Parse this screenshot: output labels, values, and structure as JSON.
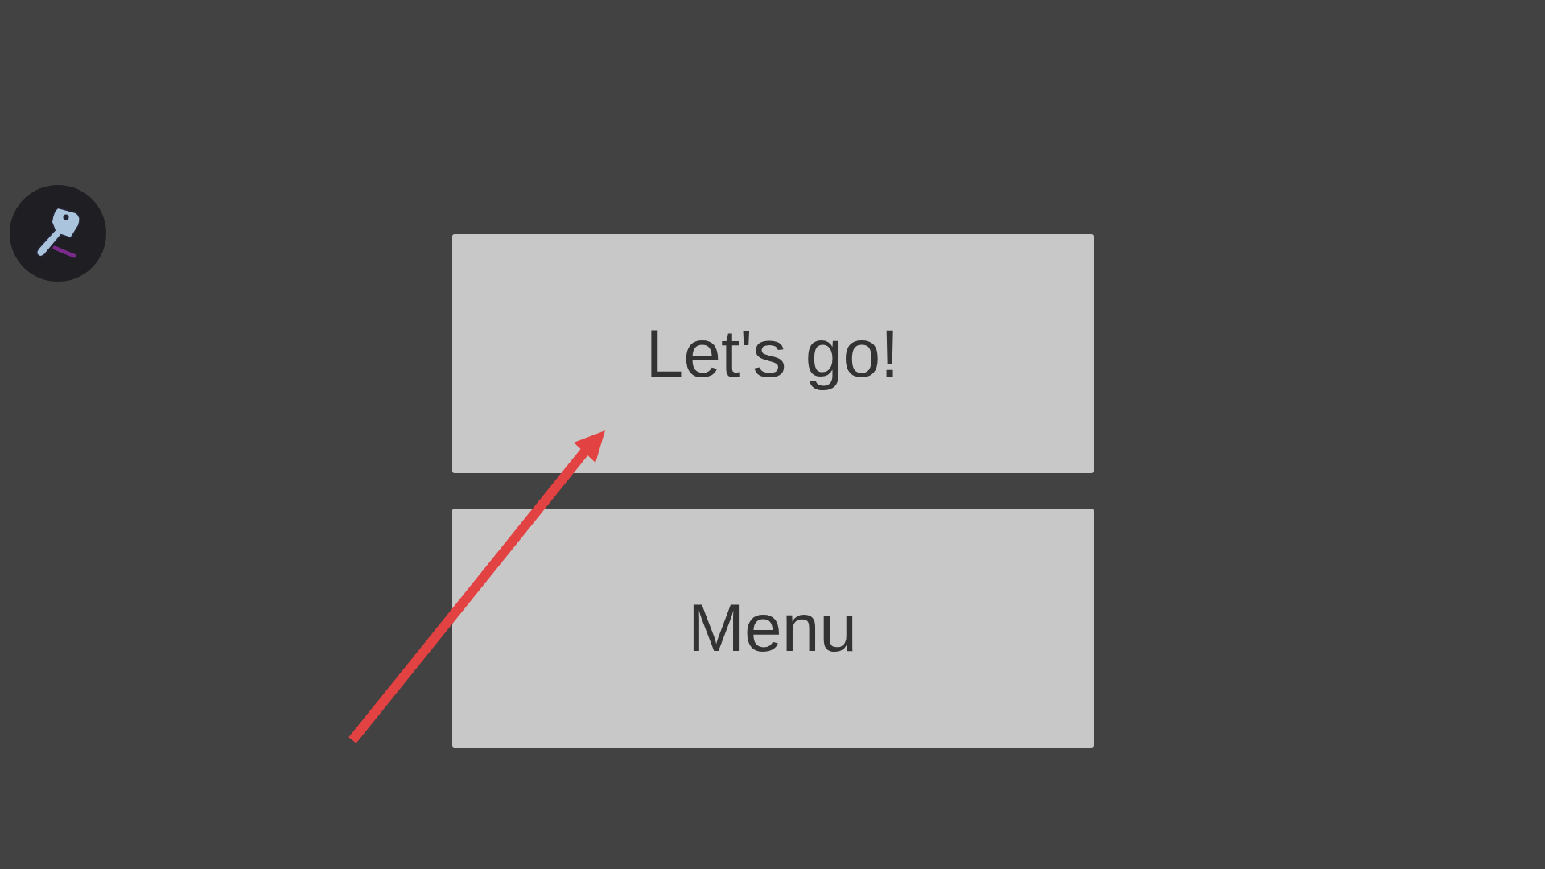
{
  "buttons": [
    {
      "label": "Let's go!"
    },
    {
      "label": "Menu"
    }
  ]
}
